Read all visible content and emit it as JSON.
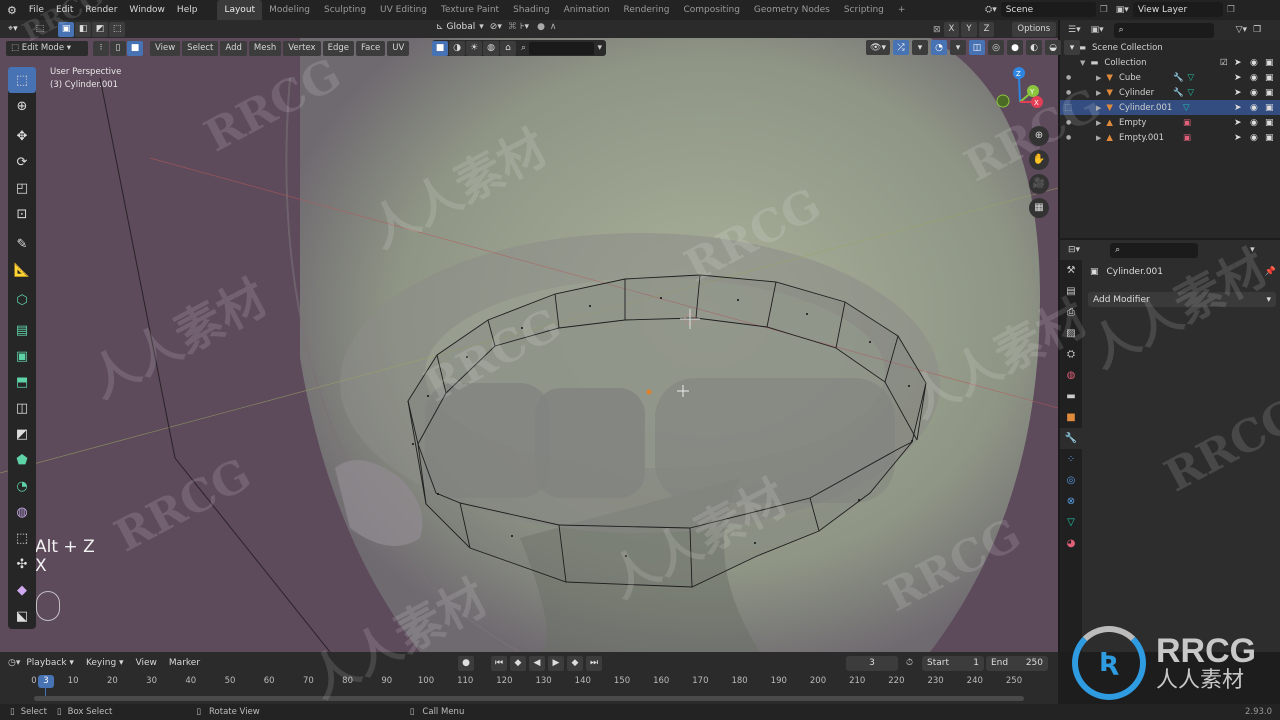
{
  "app": {
    "name": "Blender",
    "version": "2.93.0"
  },
  "topbar": {
    "menus": [
      "File",
      "Edit",
      "Render",
      "Window",
      "Help"
    ],
    "workspace_tabs": [
      {
        "label": "Layout",
        "active": true
      },
      {
        "label": "Modeling",
        "active": false
      },
      {
        "label": "Sculpting",
        "active": false
      },
      {
        "label": "UV Editing",
        "active": false
      },
      {
        "label": "Texture Paint",
        "active": false
      },
      {
        "label": "Shading",
        "active": false
      },
      {
        "label": "Animation",
        "active": false
      },
      {
        "label": "Rendering",
        "active": false
      },
      {
        "label": "Compositing",
        "active": false
      },
      {
        "label": "Geometry Nodes",
        "active": false
      },
      {
        "label": "Scripting",
        "active": false
      }
    ],
    "add_tab": "+",
    "scene": "Scene",
    "view_layer": "View Layer"
  },
  "tool_header": {
    "orientation": "Global",
    "axis_x": "X",
    "axis_y": "Y",
    "axis_z": "Z",
    "options": "Options"
  },
  "viewport_header": {
    "mode": "Edit Mode",
    "menus": [
      "View",
      "Select",
      "Add",
      "Mesh",
      "Vertex",
      "Edge",
      "Face",
      "UV"
    ]
  },
  "viewport": {
    "perspective": "User Perspective",
    "object_label": "(3) Cylinder.001",
    "key_hint_1": "Alt + Z",
    "key_hint_2": "X",
    "gizmo": {
      "x": "X",
      "y": "Y",
      "z": "Z"
    },
    "nav_icons": [
      "zoom-icon",
      "hand-pan-icon",
      "camera-icon",
      "grid-ortho-icon"
    ]
  },
  "toolbar": {
    "tools": [
      "select-box",
      "cursor",
      "move",
      "rotate",
      "scale",
      "transform",
      "annotate",
      "measure",
      "add-cube",
      "extrude",
      "inset",
      "bevel",
      "loop-cut",
      "knife",
      "poly-build",
      "spin",
      "smooth",
      "edge-slide",
      "shrink-fatten",
      "shear",
      "rip-region"
    ],
    "active": "select-box"
  },
  "outliner": {
    "search_placeholder": "",
    "root": "Scene Collection",
    "collection": "Collection",
    "items": [
      {
        "name": "Cube",
        "type": "mesh",
        "selected": false,
        "has_modifier": true
      },
      {
        "name": "Cylinder",
        "type": "mesh",
        "selected": false,
        "has_modifier": true
      },
      {
        "name": "Cylinder.001",
        "type": "mesh",
        "selected": true,
        "has_modifier": false
      },
      {
        "name": "Empty",
        "type": "empty",
        "selected": false,
        "has_modifier": false
      },
      {
        "name": "Empty.001",
        "type": "empty",
        "selected": false,
        "has_modifier": false
      }
    ]
  },
  "properties": {
    "object_name": "Cylinder.001",
    "add_modifier": "Add Modifier",
    "tabs": [
      "tool",
      "render",
      "output",
      "view-layer",
      "scene",
      "world",
      "collection",
      "object",
      "modifiers",
      "particles",
      "physics",
      "constraints",
      "data",
      "material"
    ],
    "active_tab": "modifiers"
  },
  "timeline": {
    "menus": [
      "Playback",
      "Keying",
      "View",
      "Marker"
    ],
    "current_frame": "3",
    "start_label": "Start",
    "start": "1",
    "end_label": "End",
    "end": "250",
    "ticks": [
      "0",
      "10",
      "20",
      "30",
      "40",
      "50",
      "60",
      "70",
      "80",
      "90",
      "100",
      "110",
      "120",
      "130",
      "140",
      "150",
      "160",
      "170",
      "180",
      "190",
      "200",
      "210",
      "220",
      "230",
      "240",
      "250"
    ],
    "playhead": "3"
  },
  "statusbar": {
    "select": "Select",
    "box_select": "Box Select",
    "rotate_view": "Rotate View",
    "call_menu": "Call Menu",
    "version": "2.93.0"
  },
  "watermark": {
    "latin": "RRCG",
    "cjk": "人人素材"
  },
  "colors": {
    "accent": "#4772b3",
    "selected_row": "#334d80",
    "axis_x": "#e23f56",
    "axis_y": "#8bc53f",
    "axis_z": "#2f86e0",
    "mesh_icon": "#e08a3c",
    "data_icon": "#1ec9a8"
  }
}
